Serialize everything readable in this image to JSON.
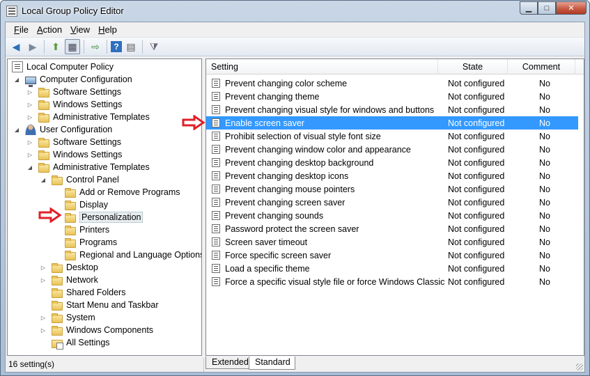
{
  "window": {
    "title": "Local Group Policy Editor"
  },
  "window_buttons": {
    "minimize": "▁",
    "maximize": "□",
    "close": "✕"
  },
  "menu": [
    {
      "label": "File",
      "u": "F",
      "rest": "ile"
    },
    {
      "label": "Action",
      "u": "A",
      "rest": "ction"
    },
    {
      "label": "View",
      "u": "V",
      "rest": "iew"
    },
    {
      "label": "Help",
      "u": "H",
      "rest": "elp"
    }
  ],
  "toolbar": {
    "back": "◀",
    "forward": "▶",
    "up": "⬆",
    "show_tree": "▦",
    "export": "⇨",
    "help": "?",
    "properties": "▤",
    "filter": "⧩"
  },
  "tree": [
    {
      "label": "Local Computer Policy",
      "icon": "book-icon"
    },
    {
      "label": "Computer Configuration",
      "icon": "computer-icon",
      "expander": "◢"
    },
    {
      "label": "Software Settings",
      "icon": "folder-icon",
      "expander": "▷"
    },
    {
      "label": "Windows Settings",
      "icon": "folder-icon",
      "expander": "▷"
    },
    {
      "label": "Administrative Templates",
      "icon": "folder-icon",
      "expander": "▷"
    },
    {
      "label": "User Configuration",
      "icon": "user-icon",
      "expander": "◢"
    },
    {
      "label": "Software Settings",
      "icon": "folder-icon",
      "expander": "▷"
    },
    {
      "label": "Windows Settings",
      "icon": "folder-icon",
      "expander": "▷"
    },
    {
      "label": "Administrative Templates",
      "icon": "folder-icon",
      "expander": "◢"
    },
    {
      "label": "Control Panel",
      "icon": "folder-icon",
      "expander": "◢"
    },
    {
      "label": "Add or Remove Programs",
      "icon": "folder-icon"
    },
    {
      "label": "Display",
      "icon": "folder-icon"
    },
    {
      "label": "Personalization",
      "icon": "folder-icon",
      "selected": true
    },
    {
      "label": "Printers",
      "icon": "folder-icon"
    },
    {
      "label": "Programs",
      "icon": "folder-icon"
    },
    {
      "label": "Regional and Language Options",
      "icon": "folder-icon"
    },
    {
      "label": "Desktop",
      "icon": "folder-icon",
      "expander": "▷"
    },
    {
      "label": "Network",
      "icon": "folder-icon",
      "expander": "▷"
    },
    {
      "label": "Shared Folders",
      "icon": "folder-icon"
    },
    {
      "label": "Start Menu and Taskbar",
      "icon": "folder-icon"
    },
    {
      "label": "System",
      "icon": "folder-icon",
      "expander": "▷"
    },
    {
      "label": "Windows Components",
      "icon": "folder-icon",
      "expander": "▷"
    },
    {
      "label": "All Settings",
      "icon": "all-settings-icon"
    }
  ],
  "list": {
    "headers": {
      "setting": "Setting",
      "state": "State",
      "comment": "Comment"
    },
    "rows": [
      {
        "setting": "Prevent changing color scheme",
        "state": "Not configured",
        "comment": "No"
      },
      {
        "setting": "Prevent changing theme",
        "state": "Not configured",
        "comment": "No"
      },
      {
        "setting": "Prevent changing visual style for windows and buttons",
        "state": "Not configured",
        "comment": "No"
      },
      {
        "setting": "Enable screen saver",
        "state": "Not configured",
        "comment": "No",
        "selected": true
      },
      {
        "setting": "Prohibit selection of visual style font size",
        "state": "Not configured",
        "comment": "No"
      },
      {
        "setting": "Prevent changing window color and appearance",
        "state": "Not configured",
        "comment": "No"
      },
      {
        "setting": "Prevent changing desktop background",
        "state": "Not configured",
        "comment": "No"
      },
      {
        "setting": "Prevent changing desktop icons",
        "state": "Not configured",
        "comment": "No"
      },
      {
        "setting": "Prevent changing mouse pointers",
        "state": "Not configured",
        "comment": "No"
      },
      {
        "setting": "Prevent changing screen saver",
        "state": "Not configured",
        "comment": "No"
      },
      {
        "setting": "Prevent changing sounds",
        "state": "Not configured",
        "comment": "No"
      },
      {
        "setting": "Password protect the screen saver",
        "state": "Not configured",
        "comment": "No"
      },
      {
        "setting": "Screen saver timeout",
        "state": "Not configured",
        "comment": "No"
      },
      {
        "setting": "Force specific screen saver",
        "state": "Not configured",
        "comment": "No"
      },
      {
        "setting": "Load a specific theme",
        "state": "Not configured",
        "comment": "No"
      },
      {
        "setting": "Force a specific visual style file or force Windows Classic",
        "state": "Not configured",
        "comment": "No"
      }
    ]
  },
  "tabs": [
    {
      "label": "Extended"
    },
    {
      "label": "Standard",
      "active": true
    }
  ],
  "status": {
    "text": "16 setting(s)"
  },
  "colors": {
    "selection": "#3399ff",
    "annotation_arrow": "#e0202a"
  }
}
